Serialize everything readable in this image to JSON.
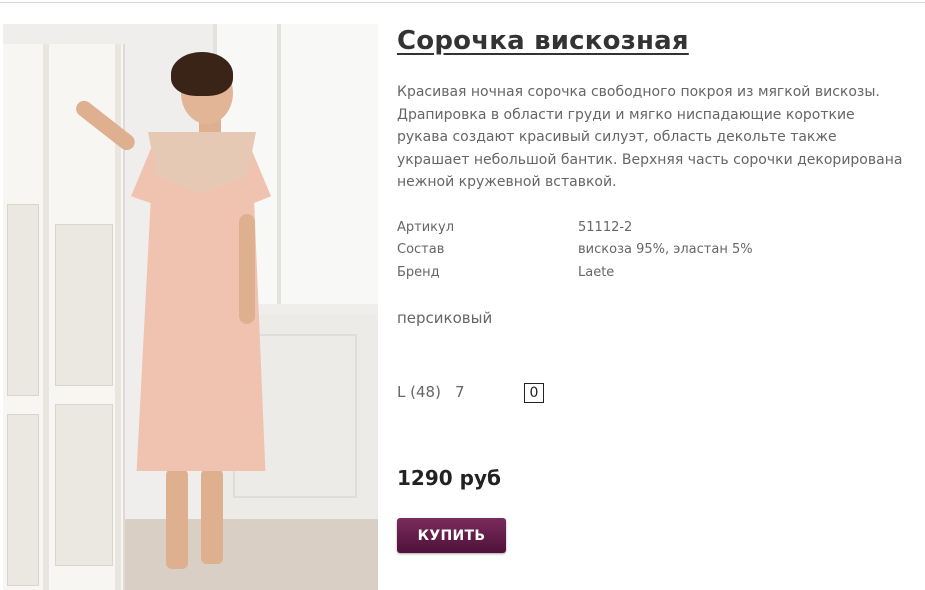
{
  "product": {
    "title": "Сорочка вискозная",
    "description": "Красивая ночная сорочка свободного покроя из мягкой вискозы. Драпировка в области груди и мягко ниспадающие короткие рукава создают красивый силуэт, область декольте также украшает небольшой бантик. Верхняя часть сорочки декорирована нежной кружевной вставкой.",
    "specs": [
      {
        "label": "Артикул",
        "value": "51112-2"
      },
      {
        "label": "Состав",
        "value": "вискоза 95%, эластан 5%"
      },
      {
        "label": "Бренд",
        "value": "Laete"
      }
    ],
    "color": "персиковый",
    "size": {
      "label": "L (48)",
      "stock": "7",
      "quantity": "0"
    },
    "price": "1290 руб",
    "buy_label": "КУПИТЬ"
  },
  "colors": {
    "buy_button_top": "#7b2b5f",
    "buy_button_bottom": "#4e1238",
    "dress_color": "#f0c3b1"
  }
}
